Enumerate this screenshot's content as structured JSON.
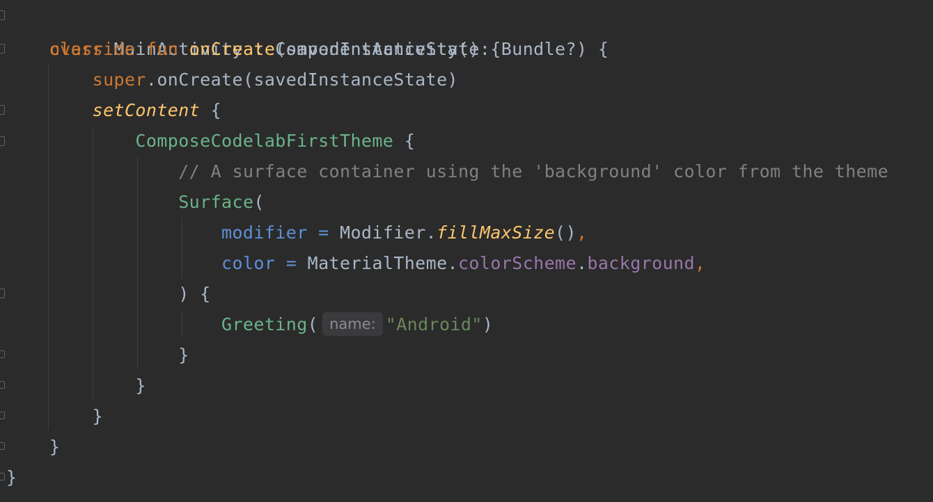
{
  "editor": {
    "lines": [
      {
        "t1": "class",
        "t2": " MainActivity : ComponentActivity() {"
      },
      {
        "t1": "override fun",
        "t2": "onCreate",
        "t3": "(savedInstanceState: Bundle?) {"
      },
      {
        "t1": "super",
        "t2": ".onCreate(savedInstanceState)"
      },
      {
        "t1": "setContent",
        "t2": " {"
      },
      {
        "t1": "ComposeCodelabFirstTheme",
        "t2": " {"
      },
      {
        "t1": "// A surface container using the 'background' color from the theme"
      },
      {
        "t1": "Surface",
        "t2": "("
      },
      {
        "t1": "modifier",
        "t2": " = ",
        "t3": "Modifier.",
        "t4": "fillMaxSize",
        "t5": "()",
        "t6": ","
      },
      {
        "t1": "color",
        "t2": " = ",
        "t3": "MaterialTheme.",
        "t4": "colorScheme",
        "t5": ".",
        "t6": "background",
        "t7": ","
      },
      {
        "t1": ") {"
      },
      {
        "t1": "Greeting",
        "t2": "(",
        "hint": "name:",
        "t3": "\"Android\"",
        "t4": ")"
      },
      {
        "t1": "}"
      },
      {
        "t1": "}"
      },
      {
        "t1": "}"
      },
      {
        "t1": "}"
      },
      {
        "t1": "}"
      }
    ]
  },
  "colors": {
    "background": "#2b2b2b",
    "keyword": "#cc7832",
    "function": "#ffc66d",
    "composable": "#6bb38a",
    "named_argument": "#5f8fd6",
    "property": "#9876aa",
    "string": "#6a8759",
    "comment": "#808080",
    "default_text": "#a9b7c6"
  }
}
